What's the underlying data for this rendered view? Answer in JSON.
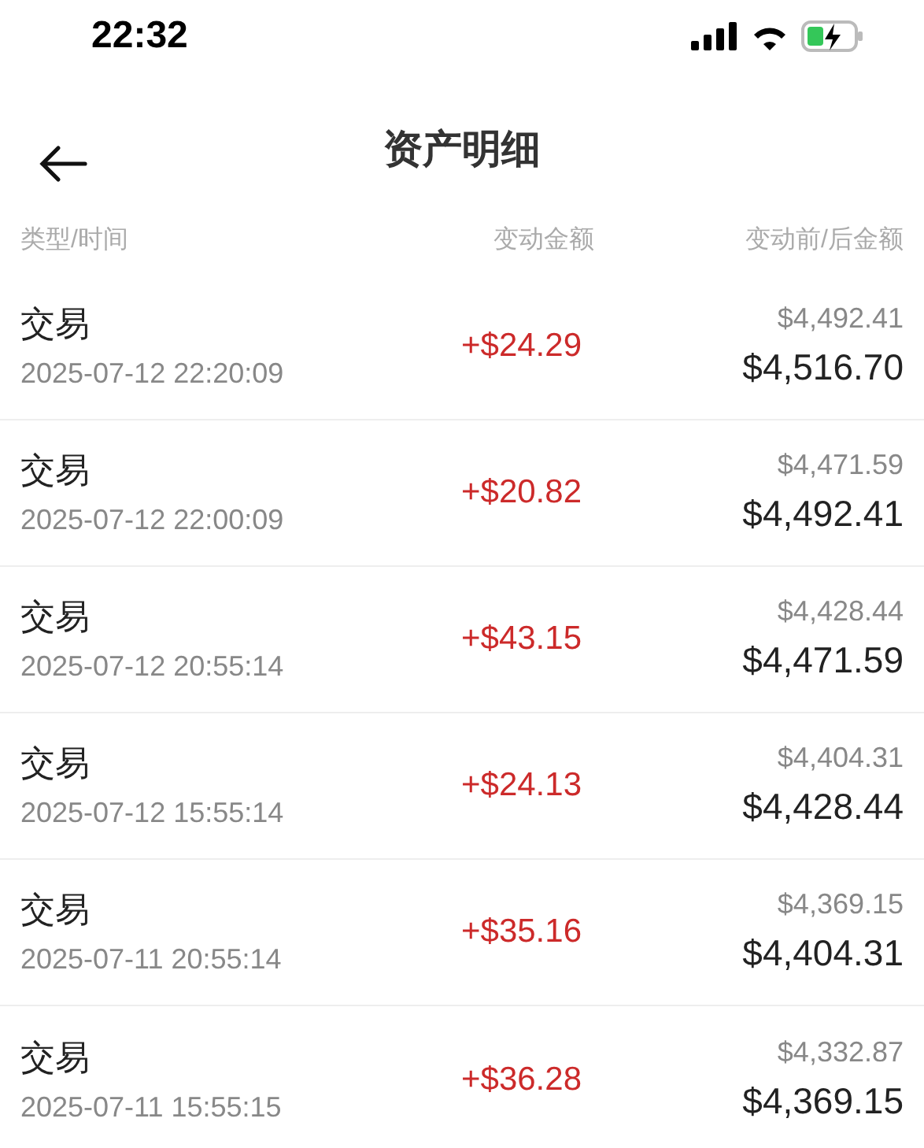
{
  "status_bar": {
    "time": "22:32"
  },
  "header": {
    "title": "资产明细"
  },
  "columns": [
    "类型/时间",
    "变动金额",
    "变动前/后金额"
  ],
  "rows": [
    {
      "type": "交易",
      "time": "2025-07-12 22:20:09",
      "change": "+$24.29",
      "before": "$4,492.41",
      "after": "$4,516.70"
    },
    {
      "type": "交易",
      "time": "2025-07-12 22:00:09",
      "change": "+$20.82",
      "before": "$4,471.59",
      "after": "$4,492.41"
    },
    {
      "type": "交易",
      "time": "2025-07-12 20:55:14",
      "change": "+$43.15",
      "before": "$4,428.44",
      "after": "$4,471.59"
    },
    {
      "type": "交易",
      "time": "2025-07-12 15:55:14",
      "change": "+$24.13",
      "before": "$4,404.31",
      "after": "$4,428.44"
    },
    {
      "type": "交易",
      "time": "2025-07-11 20:55:14",
      "change": "+$35.16",
      "before": "$4,369.15",
      "after": "$4,404.31"
    },
    {
      "type": "交易",
      "time": "2025-07-11 15:55:15",
      "change": "+$36.28",
      "before": "$4,332.87",
      "after": "$4,369.15"
    }
  ]
}
